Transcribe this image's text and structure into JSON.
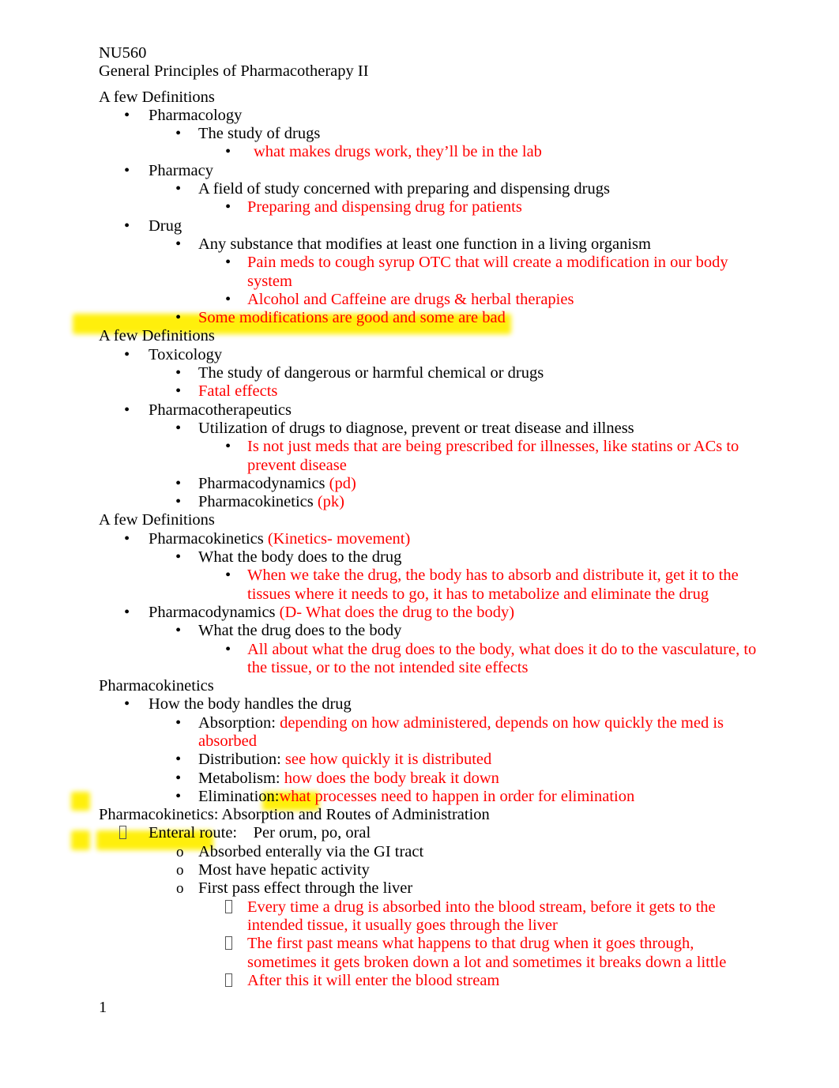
{
  "document": {
    "course_code": "NU560",
    "title": "General Principles of Pharmacotherapy II",
    "page_number": "1",
    "colors": {
      "body_text": "#000000",
      "annotation_text": "#ff0000",
      "highlight": "#fff200",
      "background": "#ffffff"
    }
  },
  "sections": [
    {
      "heading": "A few Definitions",
      "lines": [
        {
          "level": 1,
          "bullet": "dot",
          "text": "Pharmacology",
          "color": "black"
        },
        {
          "level": 2,
          "bullet": "dot",
          "text": "The study of drugs",
          "color": "black"
        },
        {
          "level": 3,
          "bullet": "dot",
          "text": "what makes drugs work, they’ll be in the lab",
          "color": "red"
        },
        {
          "level": 1,
          "bullet": "dot",
          "text": "Pharmacy",
          "color": "black"
        },
        {
          "level": 2,
          "bullet": "dot",
          "text": "A field of study concerned with preparing and dispensing drugs",
          "color": "black"
        },
        {
          "level": 3,
          "bullet": "dot",
          "text": "Preparing and dispensing drug for patients",
          "color": "red"
        },
        {
          "level": 1,
          "bullet": "dot",
          "text": "Drug",
          "color": "black"
        },
        {
          "level": 2,
          "bullet": "dot",
          "text": "Any substance that modifies at least one function in a living organism",
          "color": "black"
        },
        {
          "level": 3,
          "bullet": "dot",
          "text": "Pain meds to cough syrup OTC that will create a modification in our body system",
          "color": "red"
        },
        {
          "level": 3,
          "bullet": "dot",
          "text": "Alcohol and Caffeine are drugs & herbal therapies",
          "color": "red"
        },
        {
          "level": 2,
          "bullet": "dot",
          "text": "Some modifications are good and some are bad",
          "color": "red"
        }
      ]
    },
    {
      "heading": "A few Definitions",
      "lines": [
        {
          "level": 1,
          "bullet": "dot",
          "text": "Toxicology",
          "color": "black"
        },
        {
          "level": 2,
          "bullet": "dot",
          "text": "The study of dangerous or harmful chemical or drugs",
          "color": "black"
        },
        {
          "level": 2,
          "bullet": "dot",
          "text": "Fatal effects",
          "color": "red"
        },
        {
          "level": 1,
          "bullet": "dot",
          "text": "Pharmacotherapeutics",
          "color": "black"
        },
        {
          "level": 2,
          "bullet": "dot",
          "text": "Utilization of drugs to diagnose, prevent or treat disease and illness",
          "color": "black",
          "highlighted": true
        },
        {
          "level": 3,
          "bullet": "dot",
          "text": "Is not just meds that are being prescribed for illnesses, like statins or ACs to prevent disease",
          "color": "red"
        },
        {
          "level": 2,
          "bullet": "dot",
          "text": "Pharmacodynamics (pd)",
          "color": "mixed",
          "black_part": "Pharmacodynamics ",
          "red_part": "(pd)"
        },
        {
          "level": 2,
          "bullet": "dot",
          "text": "Pharmacokinetics (pk)",
          "color": "mixed",
          "black_part": "Pharmacokinetics ",
          "red_part": "(pk)"
        }
      ]
    },
    {
      "heading": "A few Definitions",
      "lines": [
        {
          "level": 1,
          "bullet": "dot",
          "text": "Pharmacokinetics (Kinetics- movement)",
          "color": "mixed",
          "black_part": "Pharmacokinetics ",
          "red_part": "(Kinetics- movement)"
        },
        {
          "level": 2,
          "bullet": "dot",
          "text": "What the body does to the drug",
          "color": "black"
        },
        {
          "level": 3,
          "bullet": "dot",
          "text": "When we take the drug, the body has to absorb and distribute it, get it to the tissues where it needs to go, it has to metabolize and eliminate the drug",
          "color": "red"
        },
        {
          "level": 1,
          "bullet": "dot",
          "text": "Pharmacodynamics (D- What does the drug to the body)",
          "color": "mixed",
          "black_part": "Pharmacodynamics ",
          "red_part": "(D- What does the drug to the body)"
        },
        {
          "level": 2,
          "bullet": "dot",
          "text": "What the drug does to the body",
          "color": "black"
        },
        {
          "level": 3,
          "bullet": "dot",
          "text": "All about what the drug does to the body, what does it do to the vasculature, to the tissue, or to the not intended site effects",
          "color": "red"
        }
      ]
    },
    {
      "heading": "Pharmacokinetics",
      "lines": [
        {
          "level": 1,
          "bullet": "dot",
          "text": "How the body handles the drug",
          "color": "black"
        },
        {
          "level": 2,
          "bullet": "dot",
          "text": "Absorption: depending on how administered, depends on how quickly the med is absorbed",
          "color": "mixed",
          "black_part": "Absorption:",
          "red_part": " depending on how administered, depends on how quickly the med is absorbed"
        },
        {
          "level": 2,
          "bullet": "dot",
          "text": "Distribution: see how quickly it is distributed",
          "color": "mixed",
          "black_part": "Distribution:",
          "red_part": " see how quickly it is distributed"
        },
        {
          "level": 2,
          "bullet": "dot",
          "text": "Metabolism:  how does the body break it down",
          "color": "mixed",
          "black_part": "Metabolism:",
          "red_part": "  how does the body break it down"
        },
        {
          "level": 2,
          "bullet": "dot",
          "text": "Elimination:what processes need to happen in order for elimination",
          "color": "mixed",
          "black_part": "Elimination:",
          "red_part": "what processes need to happen in order for elimination"
        }
      ]
    },
    {
      "heading": "Pharmacokinetics:  Absorption and Routes of Administration",
      "lines": [
        {
          "level": 1,
          "bullet": "box",
          "text": "Enteral route:    Per orum, po, oral",
          "color": "black"
        },
        {
          "level": 2,
          "bullet": "o",
          "text": "Absorbed enterally via the GI tract",
          "color": "black",
          "highlight_segment": "GI tract",
          "highlight_bullet": true
        },
        {
          "level": 2,
          "bullet": "o",
          "text": "Most have hepatic activity",
          "color": "black"
        },
        {
          "level": 2,
          "bullet": "o",
          "text": "First pass effect through the liver",
          "color": "black",
          "highlight_segment": "First pass effect",
          "highlight_bullet": true
        },
        {
          "level": 3,
          "bullet": "box",
          "text": "Every time a drug is absorbed into the blood stream, before it gets to the intended tissue, it usually goes through the liver",
          "color": "red"
        },
        {
          "level": 3,
          "bullet": "box",
          "text": "The first past means what happens to that drug when it goes through, sometimes it gets broken down a lot and sometimes it breaks down a little",
          "color": "red"
        },
        {
          "level": 3,
          "bullet": "box",
          "text": "After this it will enter the blood stream",
          "color": "red"
        }
      ]
    }
  ]
}
